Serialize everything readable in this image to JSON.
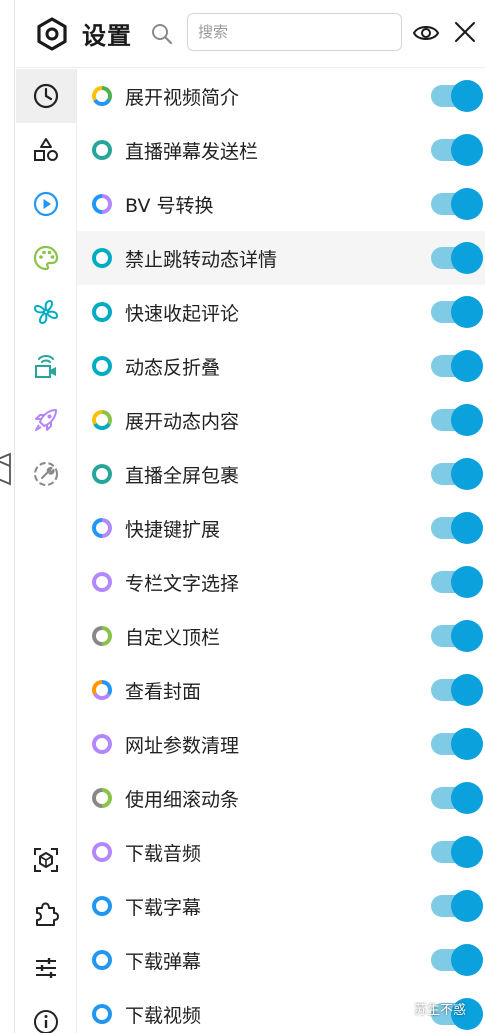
{
  "header": {
    "title": "设置",
    "search_placeholder": "搜索"
  },
  "sidebar": {
    "items": [
      {
        "icon": "clock-icon",
        "color": "#222222",
        "active": true
      },
      {
        "icon": "shapes-icon",
        "color": "#222222"
      },
      {
        "icon": "play-circle-icon",
        "color": "#2196f3"
      },
      {
        "icon": "palette-icon",
        "color": "#8bc34a"
      },
      {
        "icon": "fan-icon",
        "color": "#00acc1"
      },
      {
        "icon": "live-camera-icon",
        "color": "#26a69a"
      },
      {
        "icon": "rocket-icon",
        "color": "#b388ff"
      },
      {
        "icon": "wrench-circle-icon",
        "color": "#888888"
      },
      {
        "icon": "scan-box-icon",
        "color": "#222222"
      },
      {
        "icon": "puzzle-icon",
        "color": "#222222"
      },
      {
        "icon": "sliders-icon",
        "color": "#222222"
      },
      {
        "icon": "info-icon",
        "color": "#222222"
      }
    ]
  },
  "settings": {
    "items": [
      {
        "label": "展开视频简介",
        "ring": [
          "#4caf50",
          "#2196f3",
          "#ffc107"
        ],
        "on": true
      },
      {
        "label": "直播弹幕发送栏",
        "ring": [
          "#26a69a"
        ],
        "on": true
      },
      {
        "label": "BV 号转换",
        "ring": [
          "#b388ff",
          "#2196f3"
        ],
        "on": true
      },
      {
        "label": "禁止跳转动态详情",
        "ring": [
          "#00acc1"
        ],
        "on": true
      },
      {
        "label": "快速收起评论",
        "ring": [
          "#00acc1"
        ],
        "on": true
      },
      {
        "label": "动态反折叠",
        "ring": [
          "#00acc1"
        ],
        "on": true
      },
      {
        "label": "展开动态内容",
        "ring": [
          "#8bc34a",
          "#00acc1",
          "#ffc107"
        ],
        "on": true
      },
      {
        "label": "直播全屏包裹",
        "ring": [
          "#26a69a"
        ],
        "on": true
      },
      {
        "label": "快捷键扩展",
        "ring": [
          "#b388ff",
          "#2196f3"
        ],
        "on": true
      },
      {
        "label": "专栏文字选择",
        "ring": [
          "#b388ff"
        ],
        "on": true
      },
      {
        "label": "自定义顶栏",
        "ring": [
          "#8bc34a",
          "#888888"
        ],
        "on": true
      },
      {
        "label": "查看封面",
        "ring": [
          "#2196f3",
          "#b388ff",
          "#ff9800"
        ],
        "on": true
      },
      {
        "label": "网址参数清理",
        "ring": [
          "#b388ff"
        ],
        "on": true
      },
      {
        "label": "使用细滚动条",
        "ring": [
          "#8bc34a",
          "#888888"
        ],
        "on": true
      },
      {
        "label": "下载音频",
        "ring": [
          "#b388ff"
        ],
        "on": true
      },
      {
        "label": "下载字幕",
        "ring": [
          "#2196f3"
        ],
        "on": true
      },
      {
        "label": "下载弹幕",
        "ring": [
          "#2196f3"
        ],
        "on": true
      },
      {
        "label": "下载视频",
        "ring": [
          "#2196f3"
        ],
        "on": true
      }
    ],
    "highlighted_index": 3
  },
  "watermark": {
    "text": "苏生不惑"
  },
  "colors": {
    "toggle_track": "#7fcbe6",
    "toggle_knob": "#0aa1dd",
    "active_sidebar_bg": "#efefef"
  }
}
